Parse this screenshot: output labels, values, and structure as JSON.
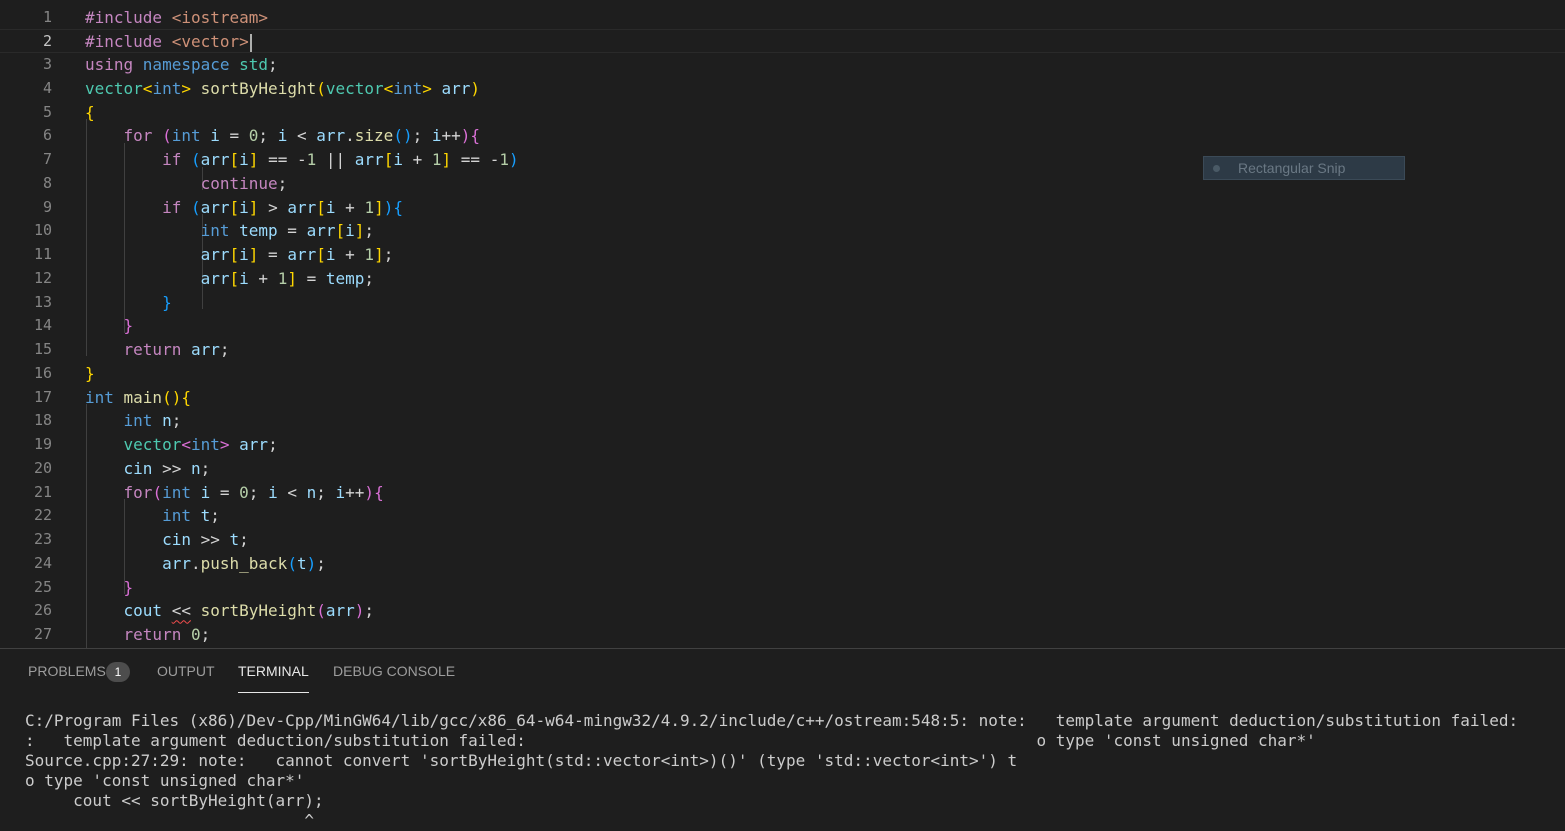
{
  "editor": {
    "line_numbers": [
      "1",
      "2",
      "3",
      "4",
      "5",
      "6",
      "7",
      "8",
      "9",
      "10",
      "11",
      "12",
      "13",
      "14",
      "15",
      "16",
      "17",
      "18",
      "19",
      "20",
      "21",
      "22",
      "23",
      "24",
      "25",
      "26",
      "27"
    ],
    "lines": [
      [
        [
          "#include ",
          "c-pre"
        ],
        [
          "<iostream>",
          "c-str"
        ]
      ],
      [
        [
          "#include ",
          "c-pre"
        ],
        [
          "<vector>",
          "c-str"
        ]
      ],
      [
        [
          "using ",
          "c-kw"
        ],
        [
          "namespace ",
          "c-type"
        ],
        [
          "std",
          "c-cls"
        ],
        [
          ";",
          ""
        ]
      ],
      [
        [
          "vector",
          "c-cls"
        ],
        [
          "<",
          "c-y"
        ],
        [
          "int",
          "c-type"
        ],
        [
          ">",
          "c-y"
        ],
        [
          " ",
          ""
        ],
        [
          "sortByHeight",
          "c-fn"
        ],
        [
          "(",
          "c-y"
        ],
        [
          "vector",
          "c-cls"
        ],
        [
          "<",
          "c-y"
        ],
        [
          "int",
          "c-type"
        ],
        [
          ">",
          "c-y"
        ],
        [
          " ",
          ""
        ],
        [
          "arr",
          "c-var"
        ],
        [
          ")",
          "c-y"
        ]
      ],
      [
        [
          "{",
          "c-y"
        ]
      ],
      [
        [
          "    ",
          ""
        ],
        [
          "for ",
          "c-kw"
        ],
        [
          "(",
          "c-p"
        ],
        [
          "int ",
          "c-type"
        ],
        [
          "i",
          "c-var"
        ],
        [
          " = ",
          ""
        ],
        [
          "0",
          "c-num"
        ],
        [
          "; ",
          ""
        ],
        [
          "i",
          "c-var"
        ],
        [
          " < ",
          ""
        ],
        [
          "arr",
          "c-var"
        ],
        [
          ".",
          ""
        ],
        [
          "size",
          "c-fn"
        ],
        [
          "()",
          "c-b"
        ],
        [
          "; ",
          ""
        ],
        [
          "i",
          "c-var"
        ],
        [
          "++",
          ""
        ],
        [
          ")",
          "c-p"
        ],
        [
          "{",
          "c-p"
        ]
      ],
      [
        [
          "        ",
          ""
        ],
        [
          "if ",
          "c-kw"
        ],
        [
          "(",
          "c-b"
        ],
        [
          "arr",
          "c-var"
        ],
        [
          "[",
          "c-y"
        ],
        [
          "i",
          "c-var"
        ],
        [
          "]",
          "c-y"
        ],
        [
          " == -",
          ""
        ],
        [
          "1",
          "c-num"
        ],
        [
          " || ",
          ""
        ],
        [
          "arr",
          "c-var"
        ],
        [
          "[",
          "c-y"
        ],
        [
          "i",
          "c-var"
        ],
        [
          " + ",
          ""
        ],
        [
          "1",
          "c-num"
        ],
        [
          "]",
          "c-y"
        ],
        [
          " == -",
          ""
        ],
        [
          "1",
          "c-num"
        ],
        [
          ")",
          "c-b"
        ]
      ],
      [
        [
          "            ",
          ""
        ],
        [
          "continue",
          "c-kw"
        ],
        [
          ";",
          ""
        ]
      ],
      [
        [
          "        ",
          ""
        ],
        [
          "if ",
          "c-kw"
        ],
        [
          "(",
          "c-b"
        ],
        [
          "arr",
          "c-var"
        ],
        [
          "[",
          "c-y"
        ],
        [
          "i",
          "c-var"
        ],
        [
          "]",
          "c-y"
        ],
        [
          " > ",
          ""
        ],
        [
          "arr",
          "c-var"
        ],
        [
          "[",
          "c-y"
        ],
        [
          "i",
          "c-var"
        ],
        [
          " + ",
          ""
        ],
        [
          "1",
          "c-num"
        ],
        [
          "]",
          "c-y"
        ],
        [
          ")",
          "c-b"
        ],
        [
          "{",
          "c-b"
        ]
      ],
      [
        [
          "            ",
          ""
        ],
        [
          "int ",
          "c-type"
        ],
        [
          "temp",
          "c-var"
        ],
        [
          " = ",
          ""
        ],
        [
          "arr",
          "c-var"
        ],
        [
          "[",
          "c-y"
        ],
        [
          "i",
          "c-var"
        ],
        [
          "]",
          "c-y"
        ],
        [
          ";",
          ""
        ]
      ],
      [
        [
          "            ",
          ""
        ],
        [
          "arr",
          "c-var"
        ],
        [
          "[",
          "c-y"
        ],
        [
          "i",
          "c-var"
        ],
        [
          "]",
          "c-y"
        ],
        [
          " = ",
          ""
        ],
        [
          "arr",
          "c-var"
        ],
        [
          "[",
          "c-y"
        ],
        [
          "i",
          "c-var"
        ],
        [
          " + ",
          ""
        ],
        [
          "1",
          "c-num"
        ],
        [
          "]",
          "c-y"
        ],
        [
          ";",
          ""
        ]
      ],
      [
        [
          "            ",
          ""
        ],
        [
          "arr",
          "c-var"
        ],
        [
          "[",
          "c-y"
        ],
        [
          "i",
          "c-var"
        ],
        [
          " + ",
          ""
        ],
        [
          "1",
          "c-num"
        ],
        [
          "]",
          "c-y"
        ],
        [
          " = ",
          ""
        ],
        [
          "temp",
          "c-var"
        ],
        [
          ";",
          ""
        ]
      ],
      [
        [
          "        ",
          ""
        ],
        [
          "}",
          "c-b"
        ]
      ],
      [
        [
          "    ",
          ""
        ],
        [
          "}",
          "c-p"
        ]
      ],
      [
        [
          "    ",
          ""
        ],
        [
          "return ",
          "c-kw"
        ],
        [
          "arr",
          "c-var"
        ],
        [
          ";",
          ""
        ]
      ],
      [
        [
          "}",
          "c-y"
        ]
      ],
      [
        [
          "int ",
          "c-type"
        ],
        [
          "main",
          "c-fn"
        ],
        [
          "()",
          "c-y"
        ],
        [
          "{",
          "c-y"
        ]
      ],
      [
        [
          "    ",
          ""
        ],
        [
          "int ",
          "c-type"
        ],
        [
          "n",
          "c-var"
        ],
        [
          ";",
          ""
        ]
      ],
      [
        [
          "    ",
          ""
        ],
        [
          "vector",
          "c-cls"
        ],
        [
          "<",
          "c-p"
        ],
        [
          "int",
          "c-type"
        ],
        [
          ">",
          "c-p"
        ],
        [
          " ",
          ""
        ],
        [
          "arr",
          "c-var"
        ],
        [
          ";",
          ""
        ]
      ],
      [
        [
          "    ",
          ""
        ],
        [
          "cin",
          "c-var"
        ],
        [
          " >> ",
          ""
        ],
        [
          "n",
          "c-var"
        ],
        [
          ";",
          ""
        ]
      ],
      [
        [
          "    ",
          ""
        ],
        [
          "for",
          "c-kw"
        ],
        [
          "(",
          "c-p"
        ],
        [
          "int ",
          "c-type"
        ],
        [
          "i",
          "c-var"
        ],
        [
          " = ",
          ""
        ],
        [
          "0",
          "c-num"
        ],
        [
          "; ",
          ""
        ],
        [
          "i",
          "c-var"
        ],
        [
          " < ",
          ""
        ],
        [
          "n",
          "c-var"
        ],
        [
          "; ",
          ""
        ],
        [
          "i",
          "c-var"
        ],
        [
          "++",
          ""
        ],
        [
          ")",
          "c-p"
        ],
        [
          "{",
          "c-p"
        ]
      ],
      [
        [
          "        ",
          ""
        ],
        [
          "int ",
          "c-type"
        ],
        [
          "t",
          "c-var"
        ],
        [
          ";",
          ""
        ]
      ],
      [
        [
          "        ",
          ""
        ],
        [
          "cin",
          "c-var"
        ],
        [
          " >> ",
          ""
        ],
        [
          "t",
          "c-var"
        ],
        [
          ";",
          ""
        ]
      ],
      [
        [
          "        ",
          ""
        ],
        [
          "arr",
          "c-var"
        ],
        [
          ".",
          ""
        ],
        [
          "push_back",
          "c-fn"
        ],
        [
          "(",
          "c-b"
        ],
        [
          "t",
          "c-var"
        ],
        [
          ")",
          "c-b"
        ],
        [
          ";",
          ""
        ]
      ],
      [
        [
          "    ",
          ""
        ],
        [
          "}",
          "c-p"
        ]
      ],
      [
        [
          "    ",
          ""
        ],
        [
          "cout",
          "c-var"
        ],
        [
          " ",
          ""
        ],
        [
          "<<",
          "squiggle"
        ],
        [
          " ",
          ""
        ],
        [
          "sortByHeight",
          "c-fn"
        ],
        [
          "(",
          "c-p"
        ],
        [
          "arr",
          "c-var"
        ],
        [
          ")",
          "c-p"
        ],
        [
          ";",
          ""
        ]
      ],
      [
        [
          "    ",
          ""
        ],
        [
          "return ",
          "c-kw"
        ],
        [
          "0",
          "c-num"
        ],
        [
          ";",
          ""
        ]
      ]
    ]
  },
  "snip_overlay": {
    "label": "Rectangular Snip"
  },
  "panel": {
    "tabs": [
      {
        "label": "PROBLEMS",
        "active": false
      },
      {
        "label": "OUTPUT",
        "active": false
      },
      {
        "label": "TERMINAL",
        "active": true
      },
      {
        "label": "DEBUG CONSOLE",
        "active": false
      }
    ],
    "problems_count": "1",
    "terminal_lines": [
      "C:/Program Files (x86)/Dev-Cpp/MinGW64/lib/gcc/x86_64-w64-mingw32/4.9.2/include/c++/ostream:548:5: note:   template argument deduction/substitution failed:",
      ":   template argument deduction/substitution failed:                                                     o type 'const unsigned char*'",
      "Source.cpp:27:29: note:   cannot convert 'sortByHeight(std::vector<int>)()' (type 'std::vector<int>') t",
      "o type 'const unsigned char*'",
      "     cout << sortByHeight(arr);",
      "                             ^"
    ]
  }
}
